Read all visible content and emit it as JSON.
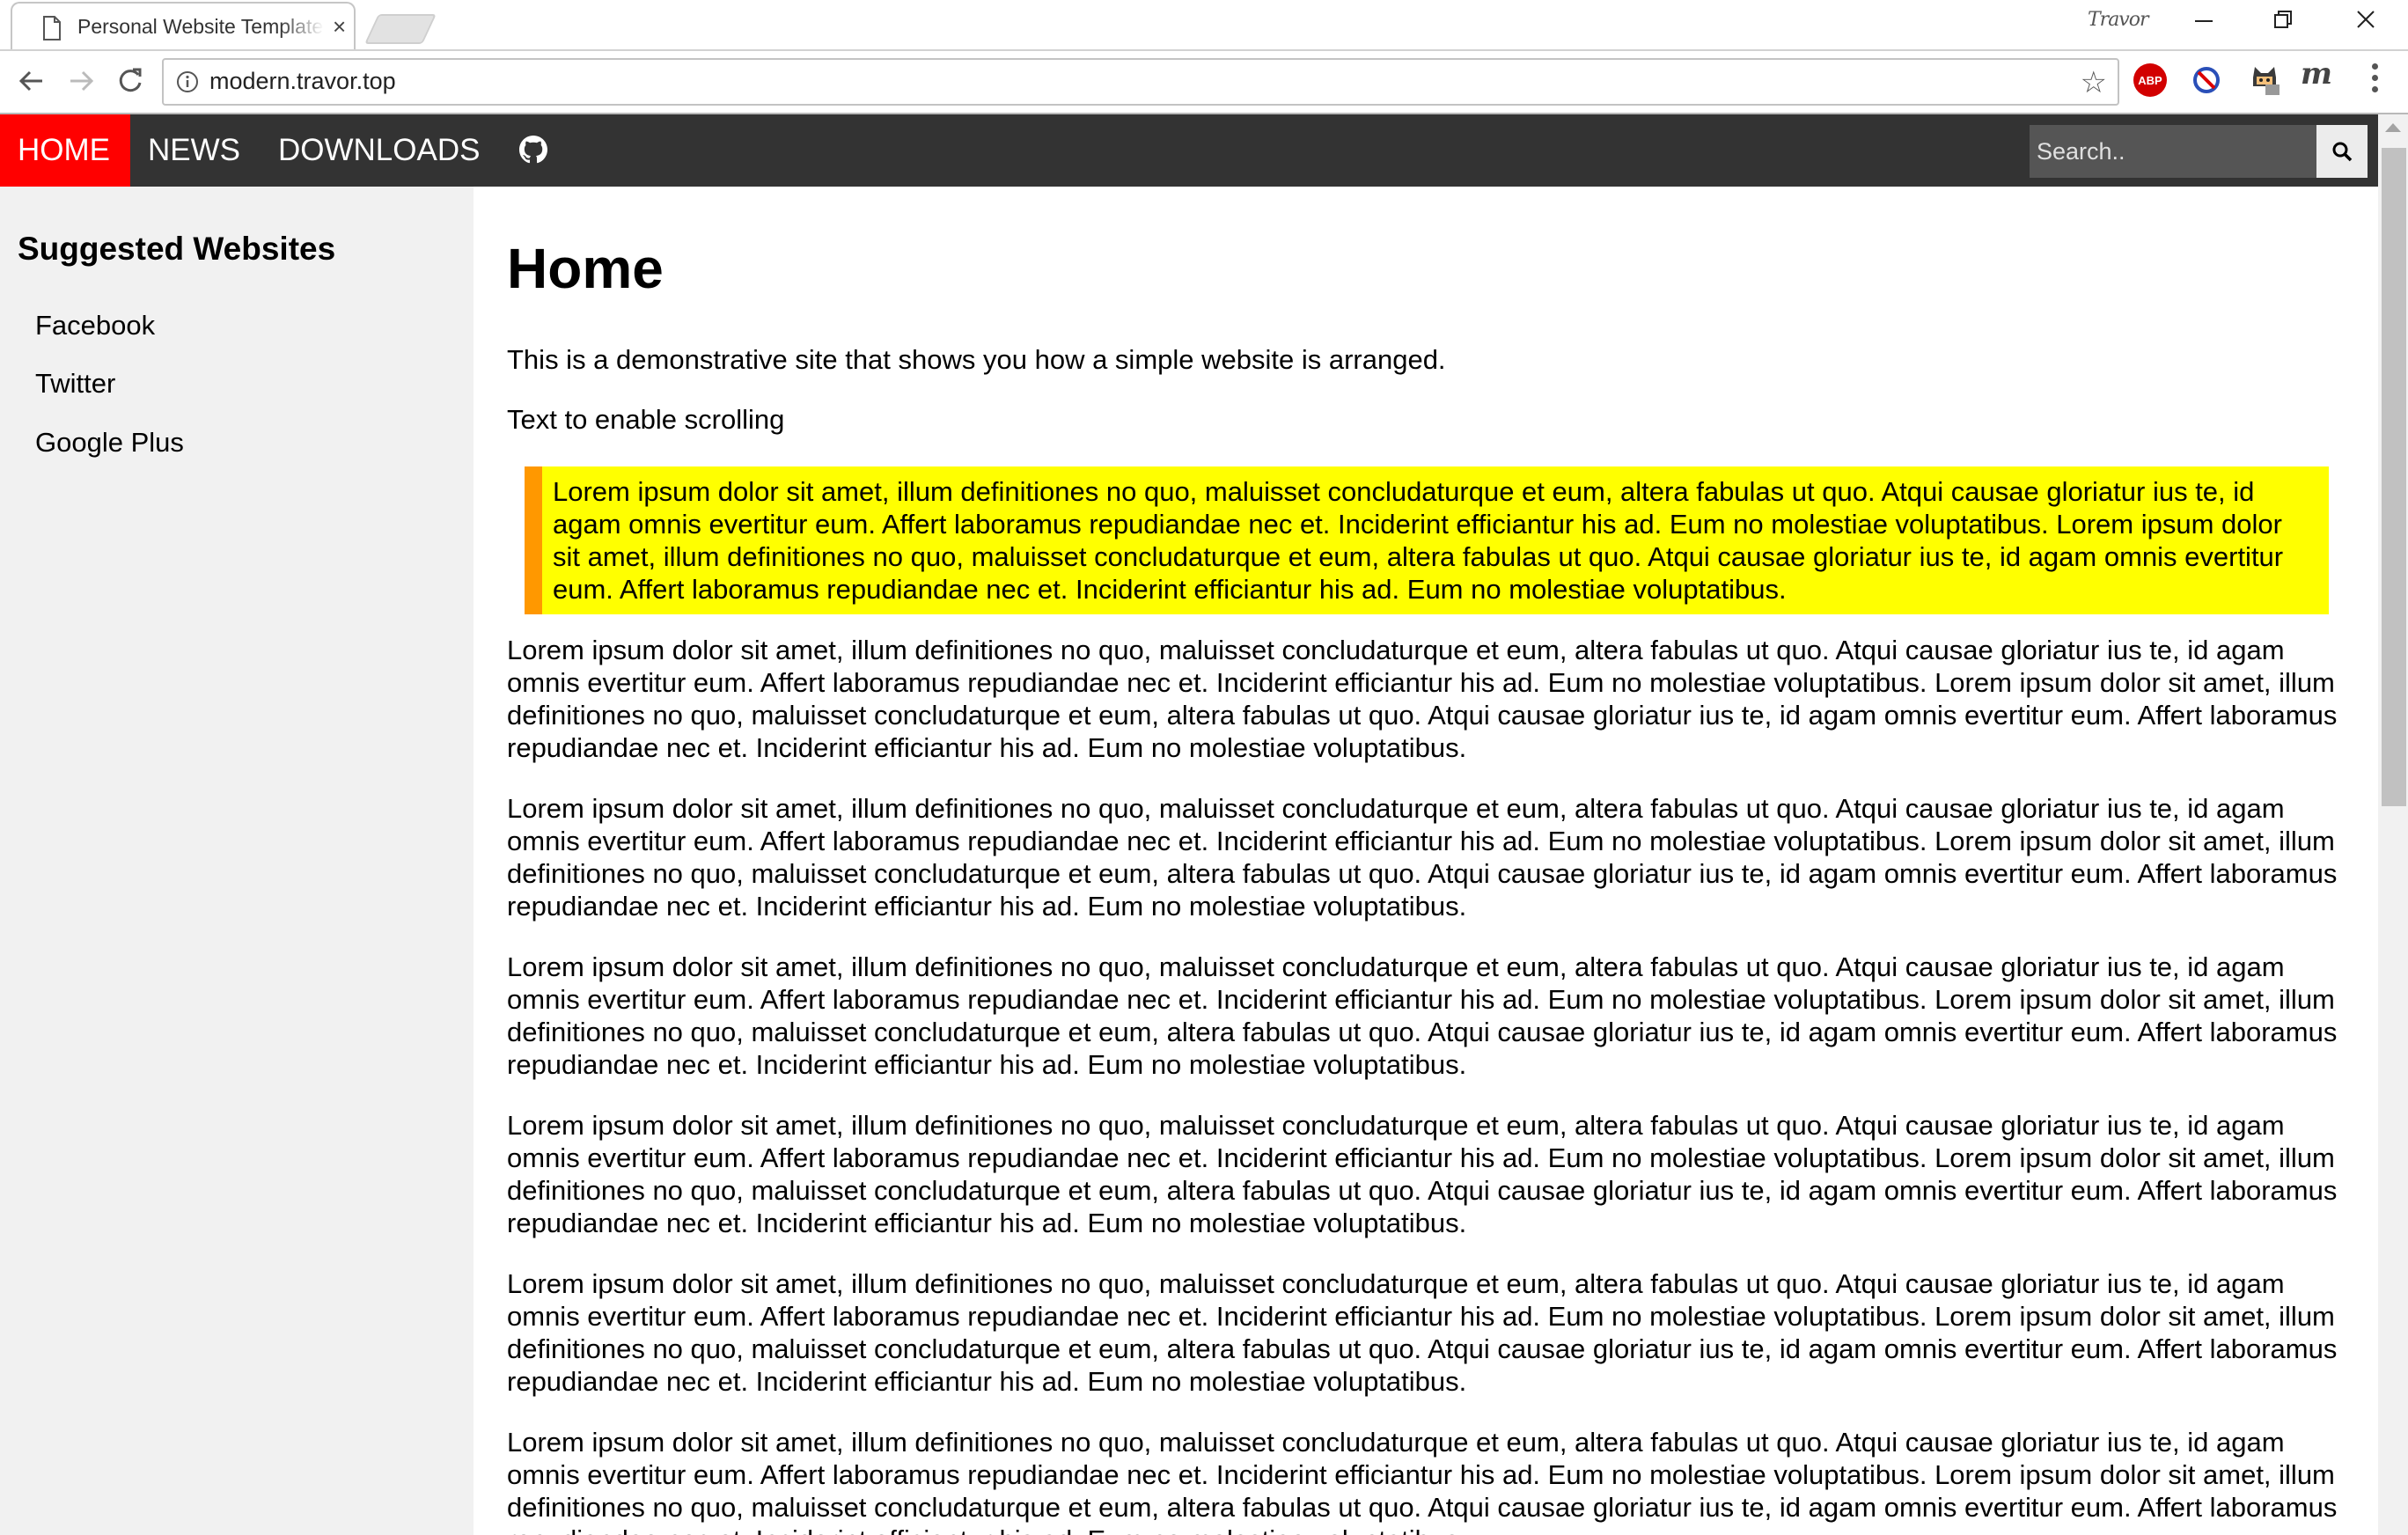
{
  "browser": {
    "tab_title": "Personal Website Template",
    "tab_close": "×",
    "profile_name": "Travor",
    "url": "modern.travor.top",
    "window_controls": [
      "minimize",
      "restore",
      "close"
    ],
    "extensions": {
      "abp_label": "ABP",
      "m_label": "m"
    }
  },
  "nav": {
    "home": "HOME",
    "news": "NEWS",
    "downloads": "DOWNLOADS",
    "github_icon": "github-icon",
    "search_placeholder": "Search..",
    "search_icon": "search-icon",
    "active_color": "#ff0000",
    "bar_color": "#333333"
  },
  "sidebar": {
    "title": "Suggested Websites",
    "links": [
      "Facebook",
      "Twitter",
      "Google Plus"
    ]
  },
  "main": {
    "heading": "Home",
    "intro": "This is a demonstrative site that shows you how a simple website is arranged.",
    "scroll_note": "Text to enable scrolling",
    "highlight": "Lorem ipsum dolor sit amet, illum definitiones no quo, maluisset concludaturque et eum, altera fabulas ut quo. Atqui causae gloriatur ius te, id agam omnis evertitur eum. Affert laboramus repudiandae nec et. Inciderint efficiantur his ad. Eum no molestiae voluptatibus. Lorem ipsum dolor sit amet, illum definitiones no quo, maluisset concludaturque et eum, altera fabulas ut quo. Atqui causae gloriatur ius te, id agam omnis evertitur eum. Affert laboramus repudiandae nec et. Inciderint efficiantur his ad. Eum no molestiae voluptatibus.",
    "paragraphs": [
      "Lorem ipsum dolor sit amet, illum definitiones no quo, maluisset concludaturque et eum, altera fabulas ut quo. Atqui causae gloriatur ius te, id agam omnis evertitur eum. Affert laboramus repudiandae nec et. Inciderint efficiantur his ad. Eum no molestiae voluptatibus. Lorem ipsum dolor sit amet, illum definitiones no quo, maluisset concludaturque et eum, altera fabulas ut quo. Atqui causae gloriatur ius te, id agam omnis evertitur eum. Affert laboramus repudiandae nec et. Inciderint efficiantur his ad. Eum no molestiae voluptatibus.",
      "Lorem ipsum dolor sit amet, illum definitiones no quo, maluisset concludaturque et eum, altera fabulas ut quo. Atqui causae gloriatur ius te, id agam omnis evertitur eum. Affert laboramus repudiandae nec et. Inciderint efficiantur his ad. Eum no molestiae voluptatibus. Lorem ipsum dolor sit amet, illum definitiones no quo, maluisset concludaturque et eum, altera fabulas ut quo. Atqui causae gloriatur ius te, id agam omnis evertitur eum. Affert laboramus repudiandae nec et. Inciderint efficiantur his ad. Eum no molestiae voluptatibus.",
      "Lorem ipsum dolor sit amet, illum definitiones no quo, maluisset concludaturque et eum, altera fabulas ut quo. Atqui causae gloriatur ius te, id agam omnis evertitur eum. Affert laboramus repudiandae nec et. Inciderint efficiantur his ad. Eum no molestiae voluptatibus. Lorem ipsum dolor sit amet, illum definitiones no quo, maluisset concludaturque et eum, altera fabulas ut quo. Atqui causae gloriatur ius te, id agam omnis evertitur eum. Affert laboramus repudiandae nec et. Inciderint efficiantur his ad. Eum no molestiae voluptatibus.",
      "Lorem ipsum dolor sit amet, illum definitiones no quo, maluisset concludaturque et eum, altera fabulas ut quo. Atqui causae gloriatur ius te, id agam omnis evertitur eum. Affert laboramus repudiandae nec et. Inciderint efficiantur his ad. Eum no molestiae voluptatibus. Lorem ipsum dolor sit amet, illum definitiones no quo, maluisset concludaturque et eum, altera fabulas ut quo. Atqui causae gloriatur ius te, id agam omnis evertitur eum. Affert laboramus repudiandae nec et. Inciderint efficiantur his ad. Eum no molestiae voluptatibus.",
      "Lorem ipsum dolor sit amet, illum definitiones no quo, maluisset concludaturque et eum, altera fabulas ut quo. Atqui causae gloriatur ius te, id agam omnis evertitur eum. Affert laboramus repudiandae nec et. Inciderint efficiantur his ad. Eum no molestiae voluptatibus. Lorem ipsum dolor sit amet, illum definitiones no quo, maluisset concludaturque et eum, altera fabulas ut quo. Atqui causae gloriatur ius te, id agam omnis evertitur eum. Affert laboramus repudiandae nec et. Inciderint efficiantur his ad. Eum no molestiae voluptatibus.",
      "Lorem ipsum dolor sit amet, illum definitiones no quo, maluisset concludaturque et eum, altera fabulas ut quo. Atqui causae gloriatur ius te, id agam omnis evertitur eum. Affert laboramus repudiandae nec et. Inciderint efficiantur his ad. Eum no molestiae voluptatibus. Lorem ipsum dolor sit amet, illum definitiones no quo, maluisset concludaturque et eum, altera fabulas ut quo. Atqui causae gloriatur ius te, id agam omnis evertitur eum. Affert laboramus repudiandae nec et. Inciderint efficiantur his ad. Eum no molestiae voluptatibus."
    ],
    "highlight_bg": "#ffff00",
    "highlight_border": "#ff9800"
  }
}
